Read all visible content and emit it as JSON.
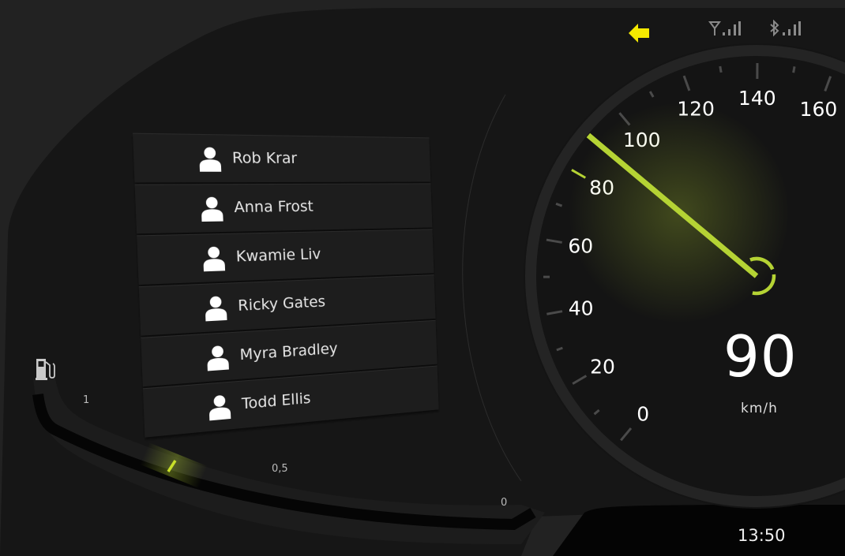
{
  "status_bar": {
    "turn_signal": {
      "icon": "arrow-left-icon",
      "direction": "left",
      "color": "#f5e900"
    },
    "cellular": {
      "icon": "antenna-signal-icon",
      "bars": 3
    },
    "bluetooth": {
      "icon": "bluetooth-signal-icon",
      "bars": 3
    }
  },
  "contacts": [
    {
      "name": "Rob Krar",
      "icon": "person-icon"
    },
    {
      "name": "Anna Frost",
      "icon": "person-icon"
    },
    {
      "name": "Kwamie Liv",
      "icon": "person-icon"
    },
    {
      "name": "Ricky Gates",
      "icon": "person-icon"
    },
    {
      "name": "Myra Bradley",
      "icon": "person-icon"
    },
    {
      "name": "Todd Ellis",
      "icon": "person-icon"
    }
  ],
  "fuel": {
    "icon": "fuel-pump-icon",
    "labels": {
      "full": "1",
      "half": "0,5",
      "empty": "0"
    },
    "level": 0.8
  },
  "speedometer": {
    "value": 90,
    "display_value": "90",
    "unit": "km/h",
    "min": 0,
    "max": 160,
    "tick_labels": [
      "0",
      "20",
      "40",
      "60",
      "80",
      "100",
      "120",
      "140",
      "160"
    ],
    "accent_color": "#b5d334"
  },
  "clock": "13:50"
}
